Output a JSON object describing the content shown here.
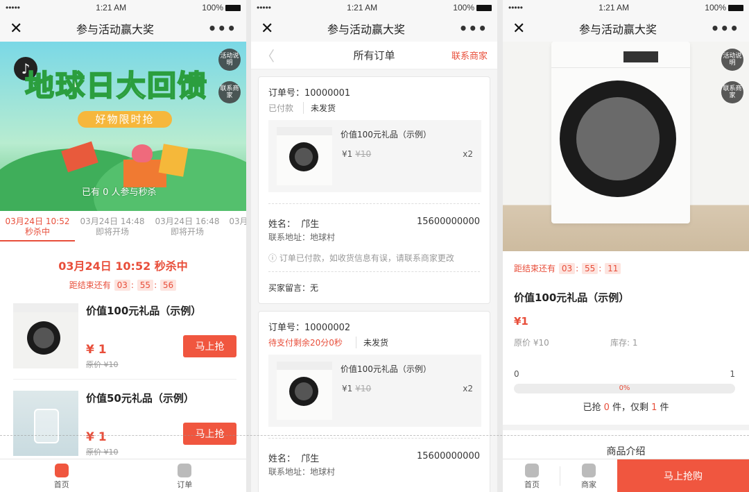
{
  "status": {
    "carrier": "•••••",
    "time": "1:21 AM",
    "battery": "100%"
  },
  "nav": {
    "title": "参与活动赢大奖",
    "close": "✕",
    "more": "•••"
  },
  "side": {
    "rules": "活动说明",
    "contact": "联系商家"
  },
  "home": {
    "banner_title": "地球日大回馈",
    "banner_sub": "好物限时抢",
    "banner_joined": "已有 0 人参与秒杀",
    "tabs": [
      {
        "time": "03月24日 10:52",
        "state": "秒杀中"
      },
      {
        "time": "03月24日 14:48",
        "state": "即将开场"
      },
      {
        "time": "03月24日 16:48",
        "state": "即将开场"
      },
      {
        "time": "03月",
        "state": ""
      }
    ],
    "sale_title": "03月24日 10:52 秒杀中",
    "countdown_label": "距结束还有",
    "countdown": [
      "03",
      "55",
      "56"
    ],
    "items": [
      {
        "name": "价值100元礼品（示例）",
        "price": "¥ 1",
        "orig": "原价 ¥10",
        "button": "马上抢"
      },
      {
        "name": "价值50元礼品（示例）",
        "price": "¥ 1",
        "orig": "原价 ¥10",
        "button": "马上抢"
      }
    ],
    "tabbar": [
      {
        "label": "首页"
      },
      {
        "label": "订单"
      }
    ]
  },
  "orders": {
    "back": "〈",
    "title": "所有订单",
    "contact": "联系商家",
    "list": [
      {
        "no": "订单号：10000001",
        "pay_status": "已付款",
        "ship_status": "未发货",
        "goods_name": "价值100元礼品（示例）",
        "goods_price": "¥1",
        "goods_orig": "¥10",
        "goods_qty": "x2",
        "name_label": "姓名：",
        "name": "邝生",
        "phone": "15600000000",
        "address": "联系地址：地球村",
        "tip": "ⓘ 订单已付款，如收货信息有误，请联系商家更改",
        "message": "买家留言：无"
      },
      {
        "no": "订单号：10000002",
        "pay_status": "待支付剩余20分0秒",
        "ship_status": "未发货",
        "goods_name": "价值100元礼品（示例）",
        "goods_price": "¥1",
        "goods_orig": "¥10",
        "goods_qty": "x2",
        "name_label": "姓名：",
        "name": "邝生",
        "phone": "15600000000",
        "address": "联系地址：地球村"
      }
    ]
  },
  "detail": {
    "countdown_label": "距结束还有",
    "countdown": [
      "03",
      "55",
      "11"
    ],
    "name": "价值100元礼品（示例）",
    "price": "¥1",
    "orig": "原价 ¥10",
    "stock": "库存: 1",
    "range_min": "0",
    "range_max": "1",
    "progress_pct": "0%",
    "progress_value": 0,
    "sold_prefix": "已抢 ",
    "sold_count": "0",
    "sold_mid": " 件，仅剩 ",
    "left_count": "1",
    "sold_suffix": " 件",
    "intro": "商品介绍",
    "footer": {
      "home": "首页",
      "shop": "商家",
      "buy": "马上抢购"
    }
  },
  "colors": {
    "accent": "#f0563f",
    "accent_text": "#e84e3a"
  }
}
